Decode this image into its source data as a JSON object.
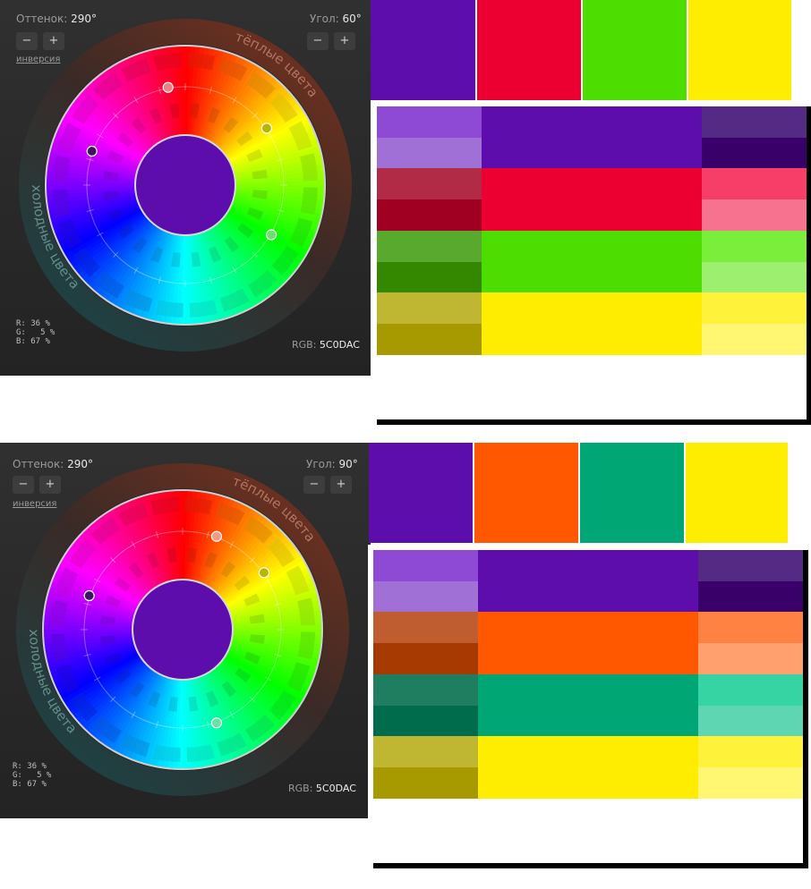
{
  "panels": [
    {
      "hue_label": "Оттенок:",
      "hue_value": "290°",
      "angle_label": "Угол:",
      "angle_value": "60°",
      "minus": "−",
      "plus": "+",
      "inversion": "инверсия",
      "warm_label": "тёплые цвета",
      "cold_label": "холодные цвета",
      "rgb_r": "R: 36 %",
      "rgb_g": "G:   5 %",
      "rgb_b": "B: 67 %",
      "rgb_hex_label": "RGB:",
      "rgb_hex_value": "5C0DAC",
      "center_color": "#5c0dac",
      "markers": [
        {
          "hue": 350,
          "color": "#f08080"
        },
        {
          "hue": 290,
          "color": "#3a1660"
        },
        {
          "hue": 55,
          "color": "#b8b400"
        },
        {
          "hue": 120,
          "color": "#6be06b"
        }
      ],
      "swatches": [
        "#5c0dac",
        "#ec0032",
        "#4ddd00",
        "#ffed00"
      ],
      "grid": [
        [
          "#8e4ad4",
          "#5c0dac",
          "#552a84"
        ],
        [
          "#a070d6",
          "#5c0dac",
          "#380068"
        ],
        [
          "#b12a46",
          "#ec0032",
          "#f73e66"
        ],
        [
          "#a00022",
          "#ec0032",
          "#f7728e"
        ],
        [
          "#58a92d",
          "#4ddd00",
          "#7aee3b"
        ],
        [
          "#338800",
          "#4ddd00",
          "#9df06f"
        ],
        [
          "#bfb631",
          "#ffed00",
          "#fff23b"
        ],
        [
          "#a69a00",
          "#ffed00",
          "#fff672"
        ]
      ]
    },
    {
      "hue_label": "Оттенок:",
      "hue_value": "290°",
      "angle_label": "Угол:",
      "angle_value": "90°",
      "minus": "−",
      "plus": "+",
      "inversion": "инверсия",
      "warm_label": "тёплые цвета",
      "cold_label": "холодные цвета",
      "rgb_r": "R: 36 %",
      "rgb_g": "G:   5 %",
      "rgb_b": "B: 67 %",
      "rgb_hex_label": "RGB:",
      "rgb_hex_value": "5C0DAC",
      "center_color": "#5c0dac",
      "markers": [
        {
          "hue": 20,
          "color": "#f59a80"
        },
        {
          "hue": 290,
          "color": "#3a1660"
        },
        {
          "hue": 55,
          "color": "#b8b400"
        },
        {
          "hue": 160,
          "color": "#6be0a0"
        }
      ],
      "swatches": [
        "#5c0dac",
        "#ff5800",
        "#00a774",
        "#ffed00"
      ],
      "grid": [
        [
          "#8e4ad4",
          "#5c0dac",
          "#552a84"
        ],
        [
          "#a070d6",
          "#5c0dac",
          "#380068"
        ],
        [
          "#bf5d30",
          "#ff5800",
          "#ff8242"
        ],
        [
          "#a63a00",
          "#ff5800",
          "#ffa06e"
        ],
        [
          "#1f7d60",
          "#00a774",
          "#35d4a2"
        ],
        [
          "#006c4b",
          "#00a774",
          "#5ed6b2"
        ],
        [
          "#bfb631",
          "#ffed00",
          "#fff23b"
        ],
        [
          "#a69a00",
          "#ffed00",
          "#fff672"
        ]
      ]
    }
  ]
}
